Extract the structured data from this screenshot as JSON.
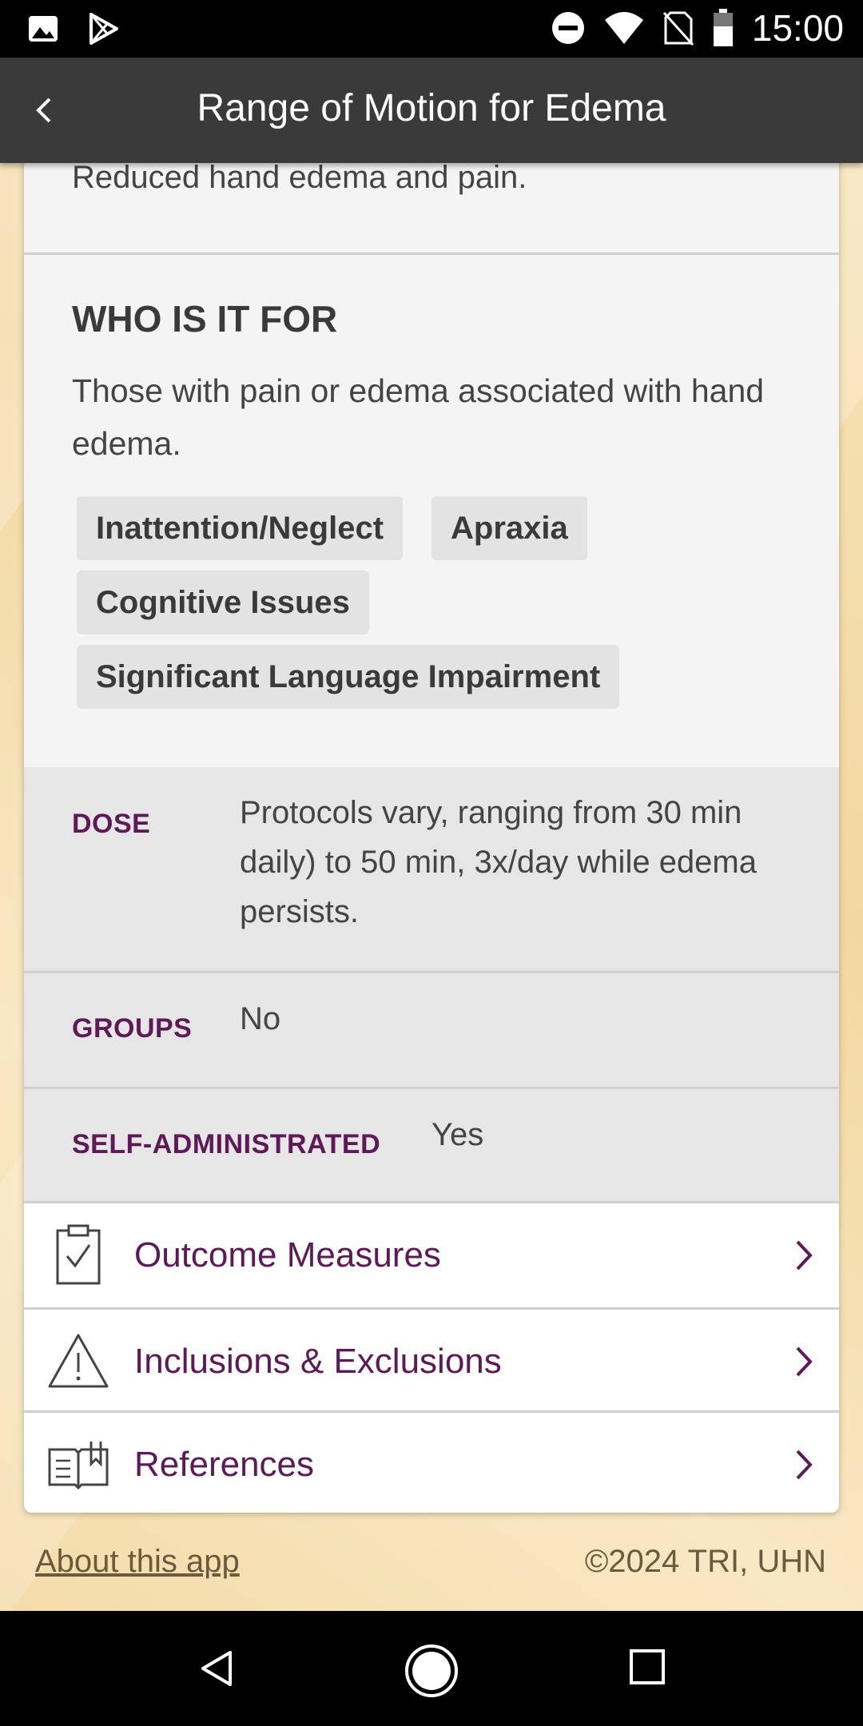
{
  "status_bar": {
    "time": "15:00",
    "left_icons": [
      "image-icon",
      "play-store-icon"
    ],
    "right_icons": [
      "do-not-disturb-icon",
      "wifi-icon",
      "no-sim-icon",
      "battery-icon"
    ]
  },
  "app_bar": {
    "title": "Range of Motion for Edema",
    "back_icon": "chevron-left-icon"
  },
  "content": {
    "result_text": "Reduced hand edema and pain.",
    "who_is_it_for": {
      "heading": "WHO IS IT FOR",
      "text": "Those with pain or edema associated with hand edema.",
      "tags": [
        "Inattention/Neglect",
        "Apraxia",
        "Cognitive Issues",
        "Significant Language Impairment"
      ]
    },
    "details": [
      {
        "label": "DOSE",
        "value": "Protocols vary, ranging from 30 min daily) to 50 min, 3x/day while edema persists."
      },
      {
        "label": "GROUPS",
        "value": "No"
      },
      {
        "label": "SELF-ADMINISTRATED",
        "value": "Yes"
      }
    ],
    "links": [
      {
        "label": "Outcome Measures",
        "icon": "clipboard-check-icon"
      },
      {
        "label": "Inclusions & Exclusions",
        "icon": "warning-triangle-icon"
      },
      {
        "label": "References",
        "icon": "open-book-icon"
      }
    ]
  },
  "footer": {
    "about_link": "About this app",
    "copyright": "©2024 TRI, UHN"
  },
  "colors": {
    "accent": "#5d1a56",
    "app_bar": "#3a3a3a",
    "background": "#f6e3b8"
  }
}
